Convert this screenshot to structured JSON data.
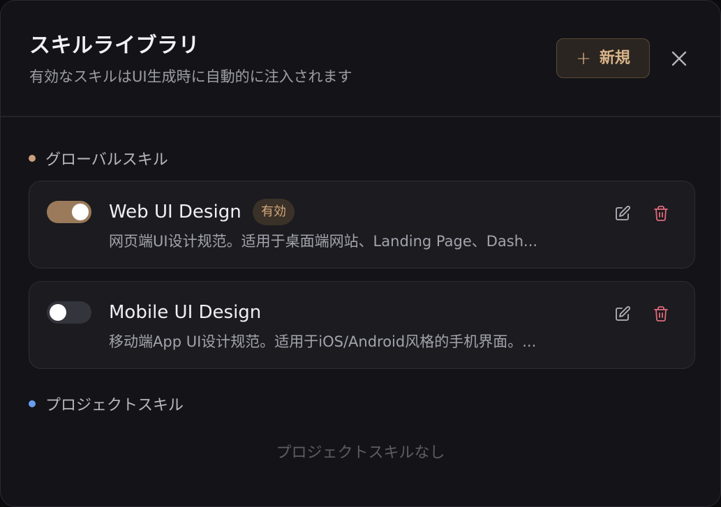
{
  "dialog": {
    "title": "スキルライブラリ",
    "subtitle": "有効なスキルはUI生成時に自動的に注入されます",
    "new_button": {
      "icon": "plus-icon",
      "label": "新規"
    },
    "close_icon": "close-icon"
  },
  "global_section": {
    "label": "グローバルスキル",
    "dot_color": "#c8a07a",
    "skills": [
      {
        "name": "Web UI Design",
        "enabled": true,
        "badge": "有効",
        "description": "网页端UI设计规范。适用于桌面端网站、Landing Page、Dash..."
      },
      {
        "name": "Mobile UI Design",
        "enabled": false,
        "badge": "",
        "description": "移动端App UI设计规范。适用于iOS/Android风格的手机界面。..."
      }
    ]
  },
  "project_section": {
    "label": "プロジェクトスキル",
    "dot_color": "#6a9ef0",
    "empty_text": "プロジェクトスキルなし"
  },
  "colors": {
    "accent": "#d9b48a",
    "toggle_on": "#9a7a5a",
    "delete": "#e06a7a",
    "background": "#141418"
  }
}
